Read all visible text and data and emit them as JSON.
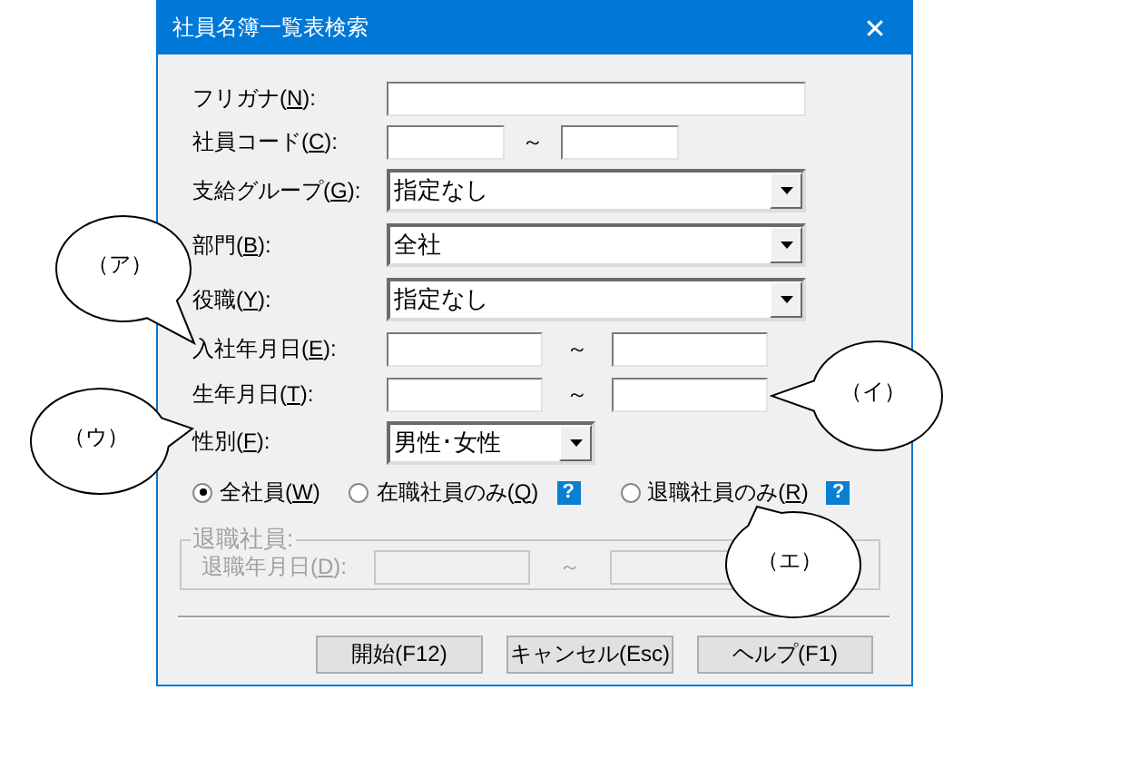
{
  "window": {
    "title": "社員名簿一覧表検索",
    "close_glyph": "✕"
  },
  "fields": [
    {
      "kind": "text",
      "label": [
        "フリガナ(",
        "N",
        "):"
      ]
    },
    {
      "kind": "range",
      "label": [
        "社員コード(",
        "C",
        "):"
      ],
      "separator": "～"
    },
    {
      "kind": "combo",
      "label": [
        "支給グループ(",
        "G",
        "):"
      ],
      "value": "指定なし"
    },
    {
      "kind": "combo",
      "label": [
        "部門(",
        "B",
        "):"
      ],
      "value": "全社"
    },
    {
      "kind": "combo",
      "label": [
        "役職(",
        "Y",
        "):"
      ],
      "value": "指定なし"
    },
    {
      "kind": "date",
      "label": [
        "入社年月日(",
        "E",
        "):"
      ],
      "separator": "～"
    },
    {
      "kind": "date",
      "label": [
        "生年月日(",
        "T",
        "):"
      ],
      "separator": "～"
    },
    {
      "kind": "short-combo",
      "label": [
        "性別(",
        "F",
        "):"
      ],
      "value": "男性･女性"
    }
  ],
  "radios": [
    {
      "label": [
        "全社員(",
        "W",
        ")"
      ],
      "selected": true
    },
    {
      "label": [
        "在職社員のみ(",
        "Q",
        ")"
      ],
      "selected": false,
      "help": "?"
    },
    {
      "label": [
        "退職社員のみ(",
        "R",
        ")"
      ],
      "selected": false,
      "help": "?"
    }
  ],
  "retired_group": {
    "title": "退職社員:",
    "label": [
      "退職年月日(",
      "D",
      "):"
    ],
    "separator": "～",
    "disabled": true
  },
  "buttons": [
    "開始(F12)",
    "キャンセル(Esc)",
    "ヘルプ(F1)"
  ],
  "callouts": [
    "（ア）",
    "（イ）",
    "（ウ）",
    "（エ）"
  ]
}
